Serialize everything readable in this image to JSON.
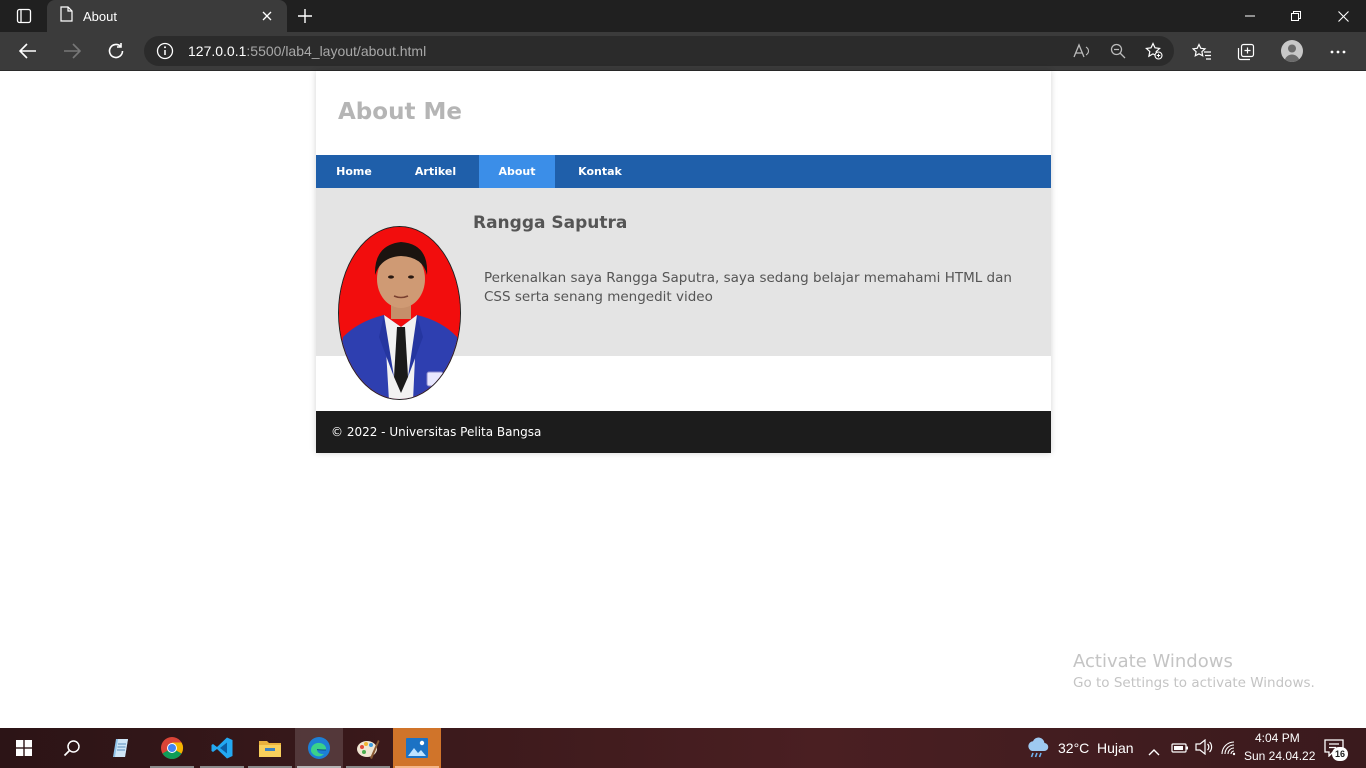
{
  "browser": {
    "tab_title": "About",
    "url_host": "127.0.0.1",
    "url_path": ":5500/lab4_layout/about.html"
  },
  "site": {
    "header_title": "About Me",
    "nav": [
      {
        "label": "Home",
        "active": false
      },
      {
        "label": "Artikel",
        "active": false
      },
      {
        "label": "About",
        "active": true
      },
      {
        "label": "Kontak",
        "active": false
      }
    ],
    "profile": {
      "name": "Rangga Saputra",
      "intro": "Perkenalkan saya Rangga Saputra, saya sedang belajar memahami HTML dan CSS serta senang mengedit video"
    },
    "footer": "© 2022 - Universitas Pelita Bangsa"
  },
  "watermark": {
    "title": "Activate Windows",
    "subtitle": "Go to Settings to activate Windows."
  },
  "taskbar": {
    "apps": [
      "start-icon",
      "search-icon",
      "notepad-icon",
      "chrome-icon",
      "vscode-icon",
      "file-explorer-icon",
      "edge-icon",
      "paint-icon",
      "photos-icon"
    ],
    "weather_temp": "32°C",
    "weather_text": "Hujan",
    "time": "4:04 PM",
    "date": "Sun 24.04.22",
    "notification_count": "16"
  },
  "colors": {
    "nav_bg": "#1f5faa",
    "nav_active": "#3b8ee8",
    "content_bg": "#e4e4e4",
    "footer_bg": "#1c1c1c",
    "photo_bg": "#f20d0d"
  }
}
